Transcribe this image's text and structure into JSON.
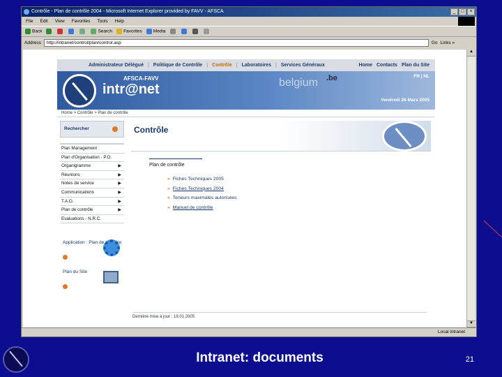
{
  "window": {
    "title": "Contrôle - Plan de contrôle 2004 - Microsoft Internet Explorer provided by FAVV - AFSCA",
    "controls": [
      "_",
      "□",
      "×"
    ]
  },
  "menu": [
    "File",
    "Edit",
    "View",
    "Favorites",
    "Tools",
    "Help"
  ],
  "toolbar": {
    "back": "Back",
    "search": "Search",
    "favorites": "Favorites",
    "media": "Media"
  },
  "address": {
    "label": "Address",
    "value": "http://intranet/control/plan/control.asp",
    "go": "Go",
    "links": "Links »"
  },
  "status": {
    "zone": "Local intranet"
  },
  "site": {
    "nav_left": [
      "Administrateur Délégué",
      "Politique de Contrôle",
      "Contrôle",
      "Laboratoires",
      "Services Généraux"
    ],
    "nav_right": [
      "Home",
      "Contacts",
      "Plan du Site"
    ],
    "banner": {
      "afsca": "AFSCA-FAVV",
      "intranet": "intr@net",
      "belgium": "belgium",
      "be": ".be",
      "langs": "FR | NL",
      "date": "Vendredi 26 Mars 2005"
    },
    "breadcrumb": "Home > Contrôle > Plan de contrôle",
    "search_label": "Rechercher",
    "left_menu": [
      {
        "label": "Plan Management",
        "arrow": ""
      },
      {
        "label": "Plan d'Organisation - P.O.",
        "arrow": ""
      },
      {
        "label": "Organigramme",
        "arrow": "▶"
      },
      {
        "label": "Réunions",
        "arrow": "▶"
      },
      {
        "label": "Notes de service",
        "arrow": "▶"
      },
      {
        "label": "Communications",
        "arrow": "▶"
      },
      {
        "label": "T.A.O.",
        "arrow": "▶"
      },
      {
        "label": "Plan de contrôle",
        "arrow": "▶"
      },
      {
        "label": "Evaluations - N.R.C.",
        "arrow": ""
      }
    ],
    "app_label": "Application : Plan de contrôle",
    "sitemap_label": "Plan du Site",
    "main_title": "Contrôle",
    "section_title": "Plan de contrôle",
    "links": [
      "Fiches Techniques 2005",
      "Fiches Techniques 2004",
      "Teneurs maximales autorisées",
      "Manuel de contrôle"
    ],
    "footer": "Dernière mise à jour : 19.01.2005"
  },
  "slide": {
    "caption": "Intranet: documents",
    "page": "21"
  }
}
